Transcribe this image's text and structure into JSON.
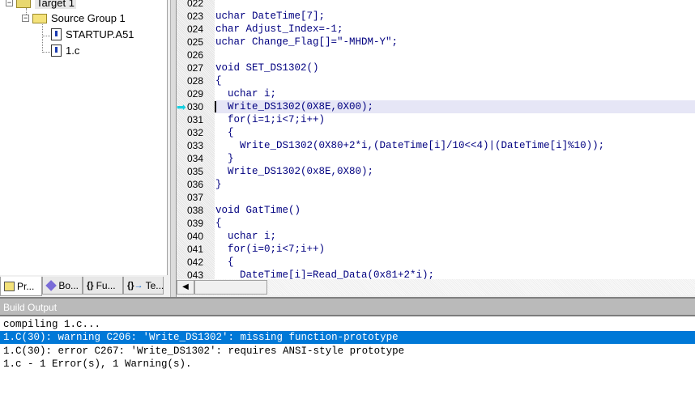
{
  "project_tree": {
    "target": "Target 1",
    "group": "Source Group 1",
    "files": [
      "STARTUP.A51",
      "1.c"
    ]
  },
  "tabs": [
    {
      "label": "Pr...",
      "icon": "project-icon"
    },
    {
      "label": "Bo...",
      "icon": "books-icon"
    },
    {
      "label": "Fu...",
      "icon": "functions-icon"
    },
    {
      "label": "Te...",
      "icon": "templates-icon"
    }
  ],
  "editor": {
    "current_line": "030",
    "lines": [
      {
        "n": "022",
        "t": ""
      },
      {
        "n": "023",
        "t": "uchar DateTime[7];"
      },
      {
        "n": "024",
        "t": "char Adjust_Index=-1;"
      },
      {
        "n": "025",
        "t": "uchar Change_Flag[]=\"-MHDM-Y\";"
      },
      {
        "n": "026",
        "t": ""
      },
      {
        "n": "027",
        "t": "void SET_DS1302()"
      },
      {
        "n": "028",
        "t": "{"
      },
      {
        "n": "029",
        "t": "  uchar i;"
      },
      {
        "n": "030",
        "t": "  Write_DS1302(0X8E,0X00);"
      },
      {
        "n": "031",
        "t": "  for(i=1;i<7;i++)"
      },
      {
        "n": "032",
        "t": "  {"
      },
      {
        "n": "033",
        "t": "    Write_DS1302(0X80+2*i,(DateTime[i]/10<<4)|(DateTime[i]%10));"
      },
      {
        "n": "034",
        "t": "  }"
      },
      {
        "n": "035",
        "t": "  Write_DS1302(0x8E,0X80);"
      },
      {
        "n": "036",
        "t": "}"
      },
      {
        "n": "037",
        "t": ""
      },
      {
        "n": "038",
        "t": "void GatTime()"
      },
      {
        "n": "039",
        "t": "{"
      },
      {
        "n": "040",
        "t": "  uchar i;"
      },
      {
        "n": "041",
        "t": "  for(i=0;i<7;i++)"
      },
      {
        "n": "042",
        "t": "  {"
      },
      {
        "n": "043",
        "t": "    DateTime[i]=Read_Data(0x81+2*i);"
      }
    ]
  },
  "build_output": {
    "title": "Build Output",
    "lines": [
      "compiling 1.c...",
      "1.C(30): warning C206: 'Write_DS1302': missing function-prototype",
      "1.C(30): error C267: 'Write_DS1302': requires ANSI-style prototype",
      "1.c - 1 Error(s), 1 Warning(s)."
    ],
    "selected_index": 1
  },
  "colors": {
    "selection": "#0078d7",
    "current_line": "#e6e6f6",
    "code_text": "#000080"
  }
}
